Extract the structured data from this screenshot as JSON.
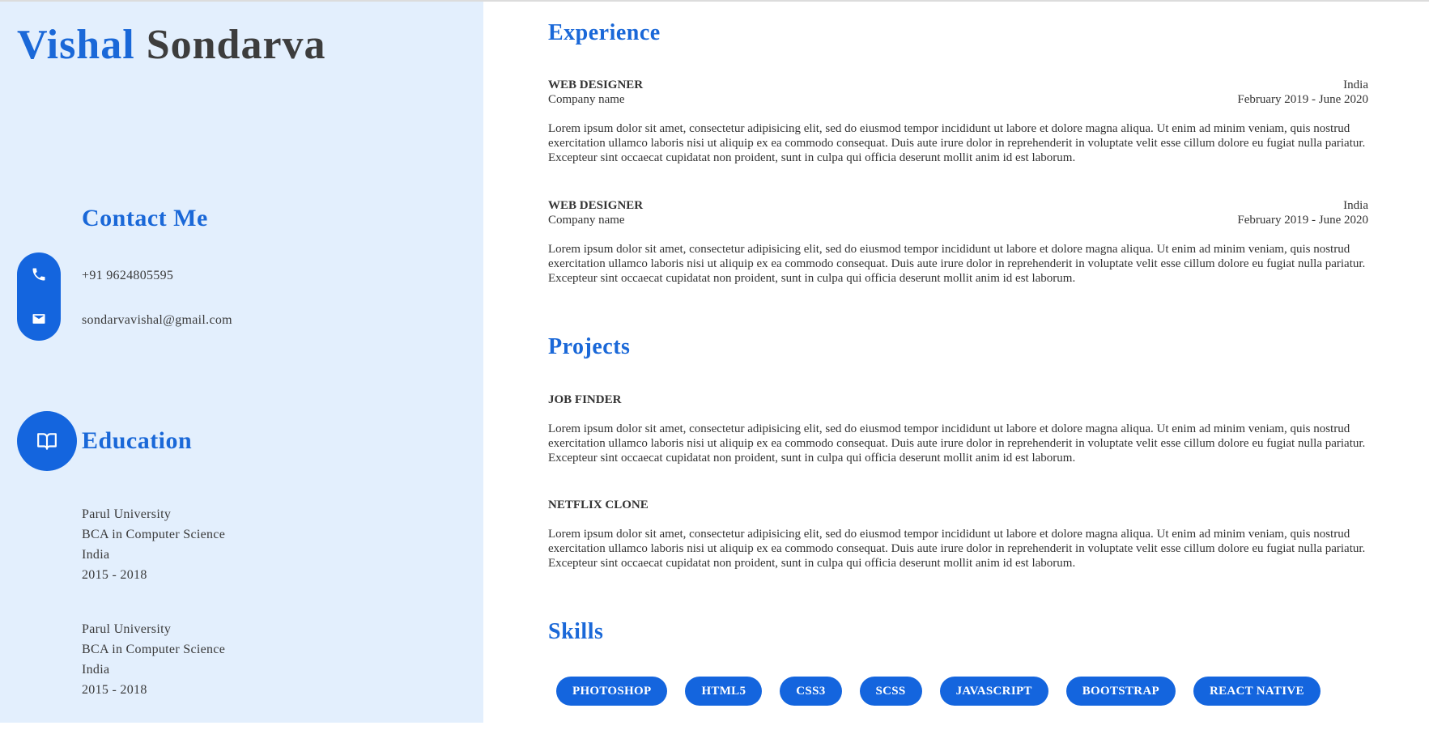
{
  "profile": {
    "first_name": "Vishal",
    "last_name": "Sondarva"
  },
  "contact": {
    "title": "Contact Me",
    "phone": "+91 9624805595",
    "email": "sondarvavishal@gmail.com",
    "phone_icon": "phone-icon",
    "email_icon": "mail-icon"
  },
  "education": {
    "title": "Education",
    "icon": "book-icon",
    "items": [
      {
        "school": "Parul University",
        "degree": "BCA in Computer Science",
        "location": "India",
        "years": "2015 - 2018"
      },
      {
        "school": "Parul University",
        "degree": "BCA in Computer Science",
        "location": "India",
        "years": "2015 - 2018"
      }
    ]
  },
  "experience": {
    "title": "Experience",
    "items": [
      {
        "role": "WEB DESIGNER",
        "location": "India",
        "company": "Company name",
        "dates": "February 2019 - June 2020",
        "description": "Lorem ipsum dolor sit amet, consectetur adipisicing elit, sed do eiusmod tempor incididunt ut labore et dolore magna aliqua. Ut enim ad minim veniam, quis nostrud exercitation ullamco laboris nisi ut aliquip ex ea commodo consequat. Duis aute irure dolor in reprehenderit in voluptate velit esse cillum dolore eu fugiat nulla pariatur. Excepteur sint occaecat cupidatat non proident, sunt in culpa qui officia deserunt mollit anim id est laborum."
      },
      {
        "role": "WEB DESIGNER",
        "location": "India",
        "company": "Company name",
        "dates": "February 2019 - June 2020",
        "description": "Lorem ipsum dolor sit amet, consectetur adipisicing elit, sed do eiusmod tempor incididunt ut labore et dolore magna aliqua. Ut enim ad minim veniam, quis nostrud exercitation ullamco laboris nisi ut aliquip ex ea commodo consequat. Duis aute irure dolor in reprehenderit in voluptate velit esse cillum dolore eu fugiat nulla pariatur. Excepteur sint occaecat cupidatat non proident, sunt in culpa qui officia deserunt mollit anim id est laborum."
      }
    ]
  },
  "projects": {
    "title": "Projects",
    "items": [
      {
        "name": "JOB FINDER",
        "description": "Lorem ipsum dolor sit amet, consectetur adipisicing elit, sed do eiusmod tempor incididunt ut labore et dolore magna aliqua. Ut enim ad minim veniam, quis nostrud exercitation ullamco laboris nisi ut aliquip ex ea commodo consequat. Duis aute irure dolor in reprehenderit in voluptate velit esse cillum dolore eu fugiat nulla pariatur. Excepteur sint occaecat cupidatat non proident, sunt in culpa qui officia deserunt mollit anim id est laborum."
      },
      {
        "name": "NETFLIX CLONE",
        "description": "Lorem ipsum dolor sit amet, consectetur adipisicing elit, sed do eiusmod tempor incididunt ut labore et dolore magna aliqua. Ut enim ad minim veniam, quis nostrud exercitation ullamco laboris nisi ut aliquip ex ea commodo consequat. Duis aute irure dolor in reprehenderit in voluptate velit esse cillum dolore eu fugiat nulla pariatur. Excepteur sint occaecat cupidatat non proident, sunt in culpa qui officia deserunt mollit anim id est laborum."
      }
    ]
  },
  "skills": {
    "title": "Skills",
    "items": [
      "PHOTOSHOP",
      "HTML5",
      "CSS3",
      "SCSS",
      "JAVASCRIPT",
      "BOOTSTRAP",
      "REACT NATIVE"
    ]
  },
  "colors": {
    "accent": "#1a68d8",
    "button": "#1465de",
    "sidebar_bg": "#e3effd",
    "text": "#333333"
  }
}
